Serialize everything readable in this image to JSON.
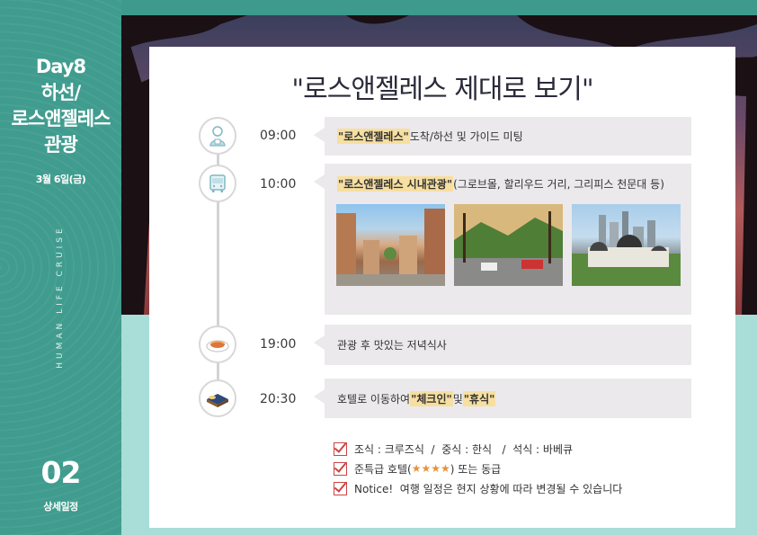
{
  "side": {
    "title_line1": "Day8",
    "title_line2": "하선/",
    "title_line3": "로스앤젤레스",
    "title_line4": "관광",
    "date": "3월 6일(금)",
    "vertical_text": "HUMAN LIFE CRUISE",
    "page_number": "02",
    "page_label": "상세일정"
  },
  "card": {
    "title": "\"로스앤젤레스 제대로 보기\""
  },
  "schedule": [
    {
      "time": "09:00",
      "icon": "guide-person-icon",
      "highlight": "\"로스앤젤레스\"",
      "text": " 도착/하선 및 가이드 미팅"
    },
    {
      "time": "10:00",
      "icon": "bus-icon",
      "highlight": "\"로스앤젤레스 시내관광\"",
      "text": " (그로브몰, 할리우드 거리, 그리피스 천문대 등)"
    },
    {
      "time": "19:00",
      "icon": "dinner-plate-icon",
      "text": "관광 후 맛있는 저녁식사"
    },
    {
      "time": "20:30",
      "icon": "hotel-bed-icon",
      "text_before": "호텔로 이동하여 ",
      "highlight1": "\"체크인\"",
      "text_mid": " 및 ",
      "highlight2": "\"휴식\""
    }
  ],
  "photos": [
    {
      "name": "the-grove-mall-photo"
    },
    {
      "name": "hollywood-street-photo"
    },
    {
      "name": "griffith-observatory-photo"
    }
  ],
  "notes": [
    {
      "text": "조식 : 크루즈식  /  중식 : 한식   /  석식 : 바베큐"
    },
    {
      "text_before": "준특급 호텔(",
      "stars": "★★★★",
      "text_after": ") 또는 동급"
    },
    {
      "text": "Notice!  여행 일정은 현지 상황에 따라 변경될 수 있습니다"
    }
  ],
  "colors": {
    "side_teal": "#3f9c8e",
    "aqua": "#a9ddd8",
    "highlight": "#f6dfa0",
    "bubble": "#ebe9eb",
    "check_red": "#cc4444",
    "star_orange": "#e7933a"
  }
}
